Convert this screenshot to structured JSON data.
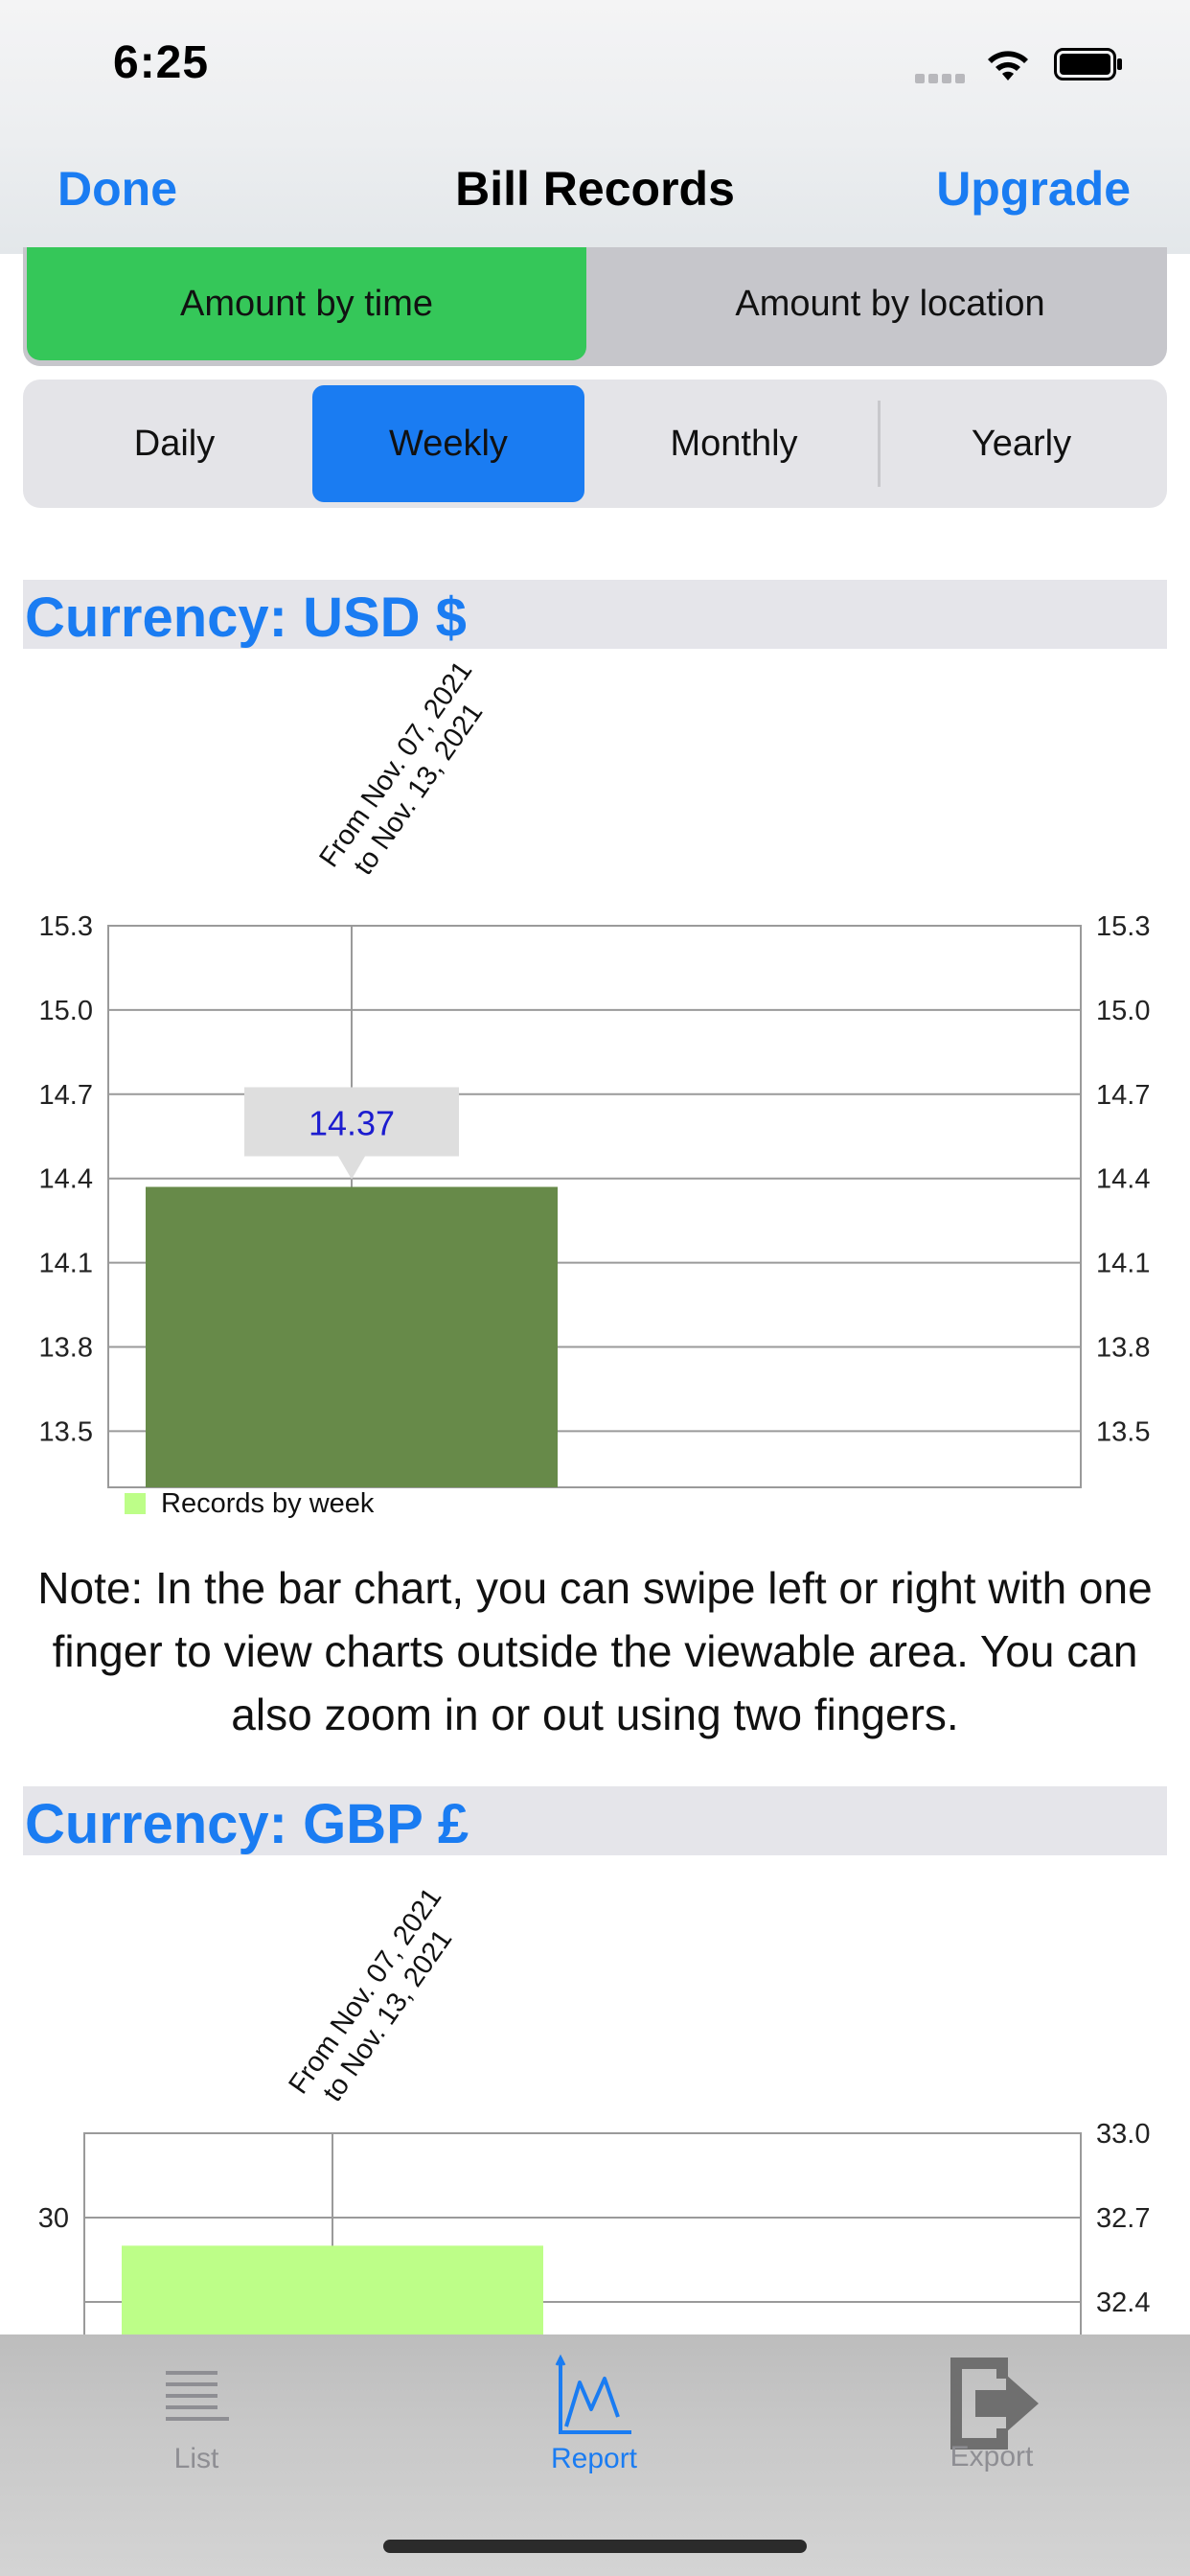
{
  "status_bar": {
    "time": "6:25"
  },
  "nav": {
    "left_button": "Done",
    "title": "Bill Records",
    "right_button": "Upgrade"
  },
  "mode_tabs": [
    {
      "label": "Amount by time",
      "selected": true
    },
    {
      "label": "Amount by location",
      "selected": false
    }
  ],
  "period_tabs": [
    {
      "label": "Daily",
      "selected": false
    },
    {
      "label": "Weekly",
      "selected": true
    },
    {
      "label": "Monthly",
      "selected": false
    },
    {
      "label": "Yearly",
      "selected": false
    }
  ],
  "sections": [
    {
      "header": "Currency: USD $"
    },
    {
      "header": "Currency: GBP £"
    }
  ],
  "note": "Note: In the bar chart, you can swipe left or right with one finger to view charts outside the viewable area. You can also  zoom in or out using two fingers.",
  "colors": {
    "accent": "#1a7cf2",
    "selected_mode": "#35c759",
    "usd_bar": "#678a49",
    "gbp_bar": "#bdfe88",
    "legend_swatch": "#bdfe88"
  },
  "chart_data": [
    {
      "type": "bar",
      "categories": [
        "From Nov. 07, 2021\nto Nov. 13, 2021"
      ],
      "category_lines": [
        "From Nov. 07, 2021",
        "to Nov. 13, 2021"
      ],
      "series": [
        {
          "name": "Records by week",
          "values": [
            14.37
          ]
        }
      ],
      "data_label": "14.37",
      "ylim": [
        13.3,
        15.3
      ],
      "yticks": [
        "15.3",
        "15.0",
        "14.7",
        "14.4",
        "14.1",
        "13.8",
        "13.5"
      ],
      "ytick_values": [
        15.3,
        15.0,
        14.7,
        14.4,
        14.1,
        13.8,
        13.5
      ],
      "right_yticks": [
        "15.3",
        "15.0",
        "14.7",
        "14.4",
        "14.1",
        "13.8",
        "13.5"
      ],
      "legend": "bottom-left",
      "grid": true
    },
    {
      "type": "bar",
      "categories": [
        "From Nov. 07, 2021\nto Nov. 13, 2021"
      ],
      "category_lines": [
        "From Nov. 07, 2021",
        "to Nov. 13, 2021"
      ],
      "series": [
        {
          "values": [
            32.6
          ]
        }
      ],
      "left_yticks": [
        "30"
      ],
      "right_yticks": [
        "33.0",
        "32.7",
        "32.4"
      ],
      "right_ytick_values": [
        33.0,
        32.7,
        32.4
      ],
      "ylim": [
        32.1,
        33.0
      ],
      "grid": true
    }
  ],
  "tab_bar": [
    {
      "label": "List",
      "icon": "list-icon",
      "selected": false
    },
    {
      "label": "Report",
      "icon": "chart-icon",
      "selected": true
    },
    {
      "label": "Export",
      "icon": "export-icon",
      "selected": false
    }
  ]
}
